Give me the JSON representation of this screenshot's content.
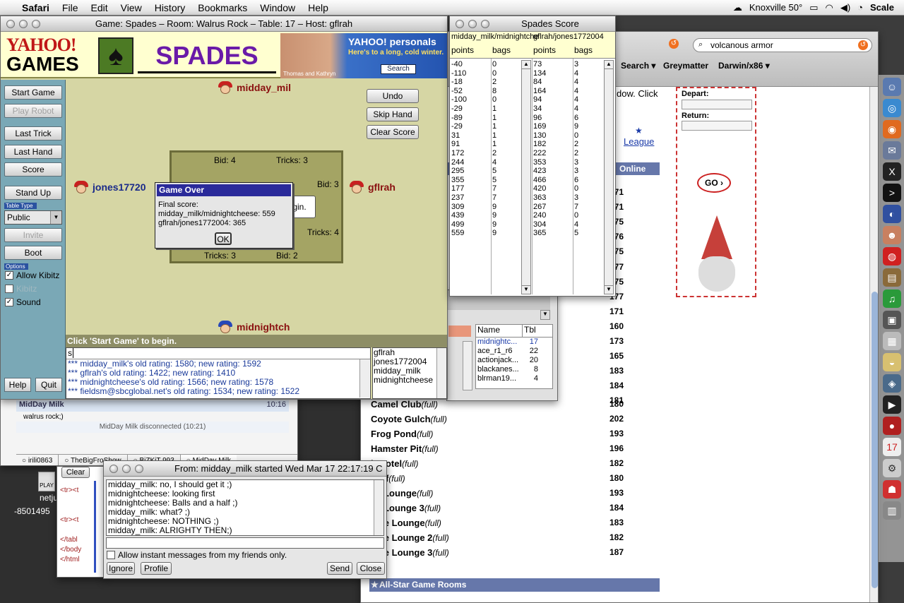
{
  "menubar": {
    "app": "Safari",
    "items": [
      "File",
      "Edit",
      "View",
      "History",
      "Bookmarks",
      "Window",
      "Help"
    ],
    "weather": "Knoxville 50°",
    "scale": "Scale"
  },
  "game_window": {
    "title": "Game: Spades – Room: Walrus Rock – Table: 17 – Host: gflrah",
    "logo_top": "YAHOO!",
    "logo_bottom": "GAMES",
    "game_name": "SPADES",
    "ad_title": "YAHOO! personals",
    "ad_text": "Here's to a long, cold winter.",
    "ad_caption": "Thomas and Kathryn",
    "ad_button": "Search",
    "left_buttons": {
      "start_game": "Start Game",
      "play_robot": "Play Robot",
      "last_trick": "Last Trick",
      "last_hand": "Last Hand",
      "score": "Score",
      "stand_up": "Stand Up",
      "invite": "Invite",
      "boot": "Boot",
      "help": "Help",
      "quit": "Quit"
    },
    "table_type_label": "Table Type",
    "table_type_value": "Public",
    "options_label": "Options",
    "options": {
      "allow_kibitz": "Allow Kibitz",
      "kibitz": "Kibitz",
      "sound": "Sound"
    },
    "right_buttons": {
      "undo": "Undo",
      "skip_hand": "Skip Hand",
      "clear_score": "Clear Score"
    },
    "players": {
      "north": "midday_mil",
      "west": "jones17720",
      "east": "gflrah",
      "south": "midnightch"
    },
    "bids": {
      "north_bid": "Bid: 4",
      "north_tricks": "Tricks: 3",
      "east_bid": "Bid: 3",
      "east_tricks": "Tricks: 4",
      "south_tricks": "Tricks: 3",
      "south_bid": "Bid: 2"
    },
    "center_msg": "gin.",
    "dialog": {
      "title": "Game Over",
      "line1": "Final score:",
      "line2": "midday_milk/midnightcheese: 559",
      "line3": "gflrah/jones1772004: 365",
      "ok": "OK"
    },
    "status": "Click 'Start Game' to begin.",
    "chat_input": "s",
    "chat_lines": [
      {
        "prefix": "***",
        "text": " midday_milk's old rating: 1580; new rating: 1592"
      },
      {
        "prefix": "***",
        "text": " gflrah's old rating: 1422; new rating: 1410"
      },
      {
        "prefix": "***",
        "text": " midnightcheese's old rating: 1566; new rating: 1578"
      },
      {
        "prefix": "***",
        "text": " fieldsm@sbcglobal.net's old rating: 1534; new rating: 1522"
      }
    ],
    "user_list": [
      "gflrah",
      "jones1772004",
      "midday_milk",
      "midnightcheese"
    ]
  },
  "score_window": {
    "title": "Spades Score",
    "team1": "midday_milk/midnightche",
    "team2": "gflrah/jones1772004",
    "col_points": "points",
    "col_bags": "bags",
    "rows": [
      [
        "-40",
        "0",
        "73",
        "3"
      ],
      [
        "-110",
        "0",
        "134",
        "4"
      ],
      [
        "-18",
        "2",
        "84",
        "4"
      ],
      [
        "-52",
        "8",
        "164",
        "4"
      ],
      [
        "-100",
        "0",
        "94",
        "4"
      ],
      [
        "-29",
        "1",
        "34",
        "4"
      ],
      [
        "-89",
        "1",
        "96",
        "6"
      ],
      [
        "-29",
        "1",
        "169",
        "9"
      ],
      [
        "31",
        "1",
        "130",
        "0"
      ],
      [
        "91",
        "1",
        "182",
        "2"
      ],
      [
        "172",
        "2",
        "222",
        "2"
      ],
      [
        "244",
        "4",
        "353",
        "3"
      ],
      [
        "295",
        "5",
        "423",
        "3"
      ],
      [
        "355",
        "5",
        "466",
        "6"
      ],
      [
        "177",
        "7",
        "420",
        "0"
      ],
      [
        "237",
        "7",
        "363",
        "3"
      ],
      [
        "309",
        "9",
        "267",
        "7"
      ],
      [
        "439",
        "9",
        "240",
        "0"
      ],
      [
        "499",
        "9",
        "304",
        "4"
      ],
      [
        "559",
        "9",
        "365",
        "5"
      ]
    ]
  },
  "lobby_window": {
    "col_name": "Name",
    "col_tbl": "Tbl",
    "rows": [
      [
        "midnightc...",
        "17"
      ],
      [
        "ace_r1_r6",
        "22"
      ],
      [
        "actionjack...",
        "20"
      ],
      [
        "blackanes...",
        "8"
      ],
      [
        "blrman19...",
        "4"
      ]
    ]
  },
  "browser": {
    "search_value": "volcanous armor",
    "bookmarks": [
      "Search ▾",
      "Greymatter",
      "Darwin/x86 ▾"
    ],
    "text_fragment": "dow. Click",
    "league": "League",
    "online_header": "Online",
    "ad_depart": "Depart:",
    "ad_return": "Return:",
    "ad_go": "GO ›",
    "counts_top": [
      "171",
      "171",
      "175",
      "176",
      "175",
      "177",
      "175",
      "177",
      "171",
      "160",
      "173",
      "165",
      "183",
      "184",
      "181"
    ],
    "rooms": [
      {
        "name": "Camel Club",
        "tag": "(full)",
        "count": "180"
      },
      {
        "name": "Coyote Gulch",
        "tag": "(full)",
        "count": "202"
      },
      {
        "name": "Frog Pond",
        "tag": "(full)",
        "count": "193"
      },
      {
        "name": "Hamster Pit",
        "tag": "(full)",
        "count": "196"
      },
      {
        "name": "h Hotel",
        "tag": "(full)",
        "count": "182"
      },
      {
        "name": "Cliff",
        "tag": "(full)",
        "count": "180"
      },
      {
        "name": "ial Lounge",
        "tag": "(full)",
        "count": "193"
      },
      {
        "name": "ial Lounge 3",
        "tag": "(full)",
        "count": "184"
      },
      {
        "name": "side Lounge",
        "tag": "(full)",
        "count": "183"
      },
      {
        "name": "side Lounge 2",
        "tag": "(full)",
        "count": "182"
      },
      {
        "name": "side Lounge 3",
        "tag": "(full)",
        "count": "187"
      }
    ],
    "allstar": "All-Star Game Rooms"
  },
  "messenger": {
    "contact": "MidDay Milk",
    "time": "10:16",
    "msg": "walrus rock;)",
    "disconnected": "MidDay Milk disconnected (10:21)",
    "tabs": [
      "irili0863",
      "TheBigFroShow",
      "BiZKiT 993",
      "MidDay Milk"
    ],
    "clear": "Clear"
  },
  "im_window": {
    "title": "From: midday_milk started Wed Mar 17 22:17:19 C",
    "lines": [
      "midday_milk: no, I should get it ;)",
      "midnightcheese:  looking  first",
      "midnightcheese: Balls and a half ;)",
      "midday_milk: what? ;)",
      "midnightcheese: NOTHING ;)",
      "midday_milk: ALRIGHTY THEN;)"
    ],
    "allow_label": "Allow instant messages from my friends only.",
    "ignore": "Ignore",
    "profile": "Profile",
    "send": "Send",
    "close": "Close"
  },
  "desktop": {
    "itunes_label": "PLAY",
    "netjuke": "netjuk",
    "phone": "-8501495"
  },
  "code_snippet": [
    "<tr><t",
    "<tr><t",
    "</tabl",
    "</body",
    "</html"
  ]
}
